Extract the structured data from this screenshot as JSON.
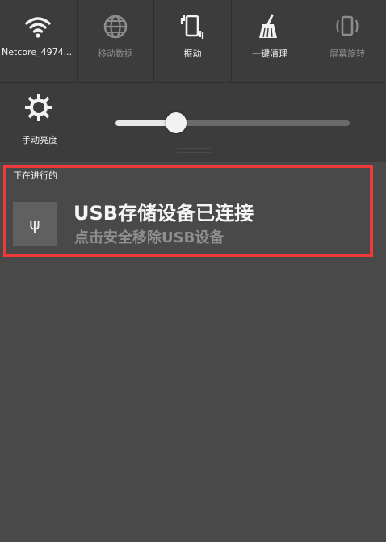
{
  "quick_settings": {
    "toggles": [
      {
        "label": "Netcore_4974...",
        "icon": "wifi-icon",
        "state": "on"
      },
      {
        "label": "移动数据",
        "icon": "globe-icon",
        "state": "off"
      },
      {
        "label": "振动",
        "icon": "vibrate-icon",
        "state": "on"
      },
      {
        "label": "一键清理",
        "icon": "broom-icon",
        "state": "on"
      },
      {
        "label": "屏幕旋转",
        "icon": "rotate-icon",
        "state": "off"
      }
    ]
  },
  "brightness": {
    "label": "手动亮度",
    "icon": "brightness-gear-icon",
    "level_fraction": 0.26
  },
  "ongoing": {
    "section_label": "正在进行的",
    "notification": {
      "icon": "usb-icon",
      "icon_glyph": "ψ",
      "title": "USB存储设备已连接",
      "subtitle": "点击安全移除USB设备"
    }
  },
  "colors": {
    "highlight": "#ee3a3a",
    "background": "#494949"
  }
}
